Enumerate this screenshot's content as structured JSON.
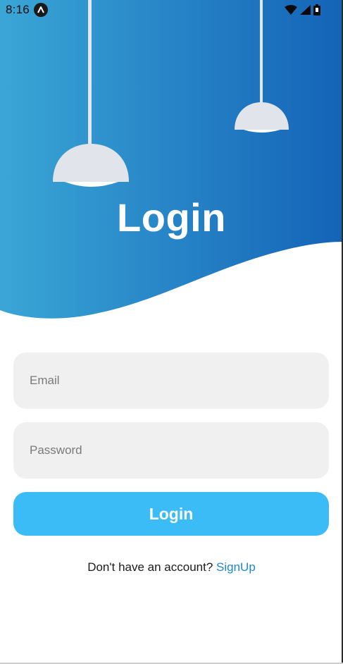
{
  "status_bar": {
    "time": "8:16",
    "icons": [
      "app-notification-icon",
      "wifi-icon",
      "cellular-signal-icon",
      "battery-icon"
    ]
  },
  "header": {
    "title": "Login",
    "gradient_start": "#3aa6d6",
    "gradient_end": "#1463b7"
  },
  "form": {
    "email_placeholder": "Email",
    "password_placeholder": "Password",
    "login_label": "Login"
  },
  "signup": {
    "prompt": "Don't have an account?",
    "link_label": "SignUp"
  },
  "colors": {
    "button": "#3bbcf6",
    "field_bg": "#f0f0f1",
    "link": "#1e88c8"
  }
}
